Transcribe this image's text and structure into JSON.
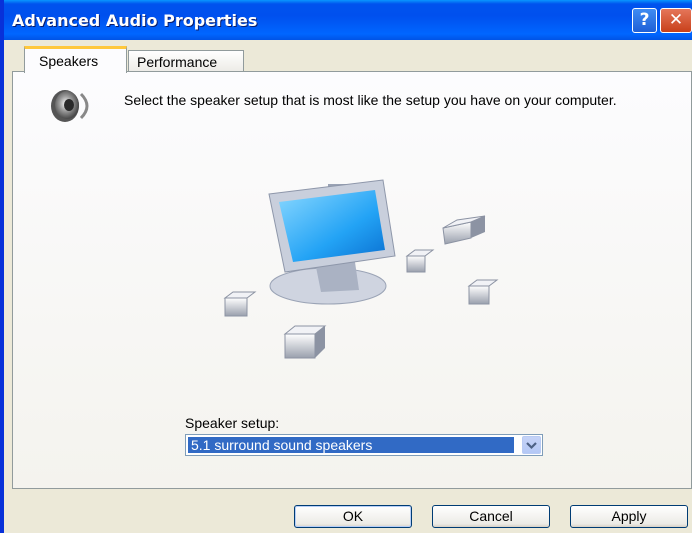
{
  "window": {
    "title": "Advanced Audio Properties",
    "help_glyph": "?",
    "close_glyph": "✕"
  },
  "tabs": [
    {
      "label": "Speakers",
      "selected": true
    },
    {
      "label": "Performance",
      "selected": false
    }
  ],
  "speakers": {
    "description": "Select the speaker setup that is most like the setup you have on your computer.",
    "setup_label": "Speaker setup:",
    "setup_value": "5.1 surround sound speakers"
  },
  "buttons": {
    "ok": "OK",
    "cancel": "Cancel",
    "apply": "Apply"
  },
  "colors": {
    "titlebar": "#0053ee",
    "selection": "#316ac5",
    "tab_highlight": "#ffc83c"
  }
}
